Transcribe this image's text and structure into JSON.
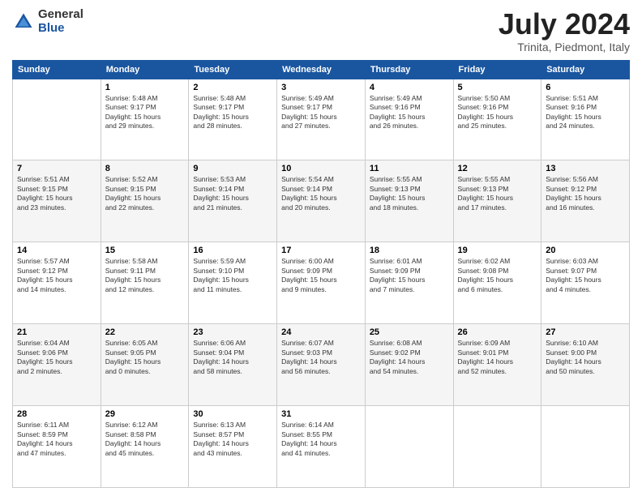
{
  "logo": {
    "general": "General",
    "blue": "Blue"
  },
  "title": "July 2024",
  "subtitle": "Trinita, Piedmont, Italy",
  "weekdays": [
    "Sunday",
    "Monday",
    "Tuesday",
    "Wednesday",
    "Thursday",
    "Friday",
    "Saturday"
  ],
  "weeks": [
    [
      {
        "day": "",
        "info": ""
      },
      {
        "day": "1",
        "info": "Sunrise: 5:48 AM\nSunset: 9:17 PM\nDaylight: 15 hours\nand 29 minutes."
      },
      {
        "day": "2",
        "info": "Sunrise: 5:48 AM\nSunset: 9:17 PM\nDaylight: 15 hours\nand 28 minutes."
      },
      {
        "day": "3",
        "info": "Sunrise: 5:49 AM\nSunset: 9:17 PM\nDaylight: 15 hours\nand 27 minutes."
      },
      {
        "day": "4",
        "info": "Sunrise: 5:49 AM\nSunset: 9:16 PM\nDaylight: 15 hours\nand 26 minutes."
      },
      {
        "day": "5",
        "info": "Sunrise: 5:50 AM\nSunset: 9:16 PM\nDaylight: 15 hours\nand 25 minutes."
      },
      {
        "day": "6",
        "info": "Sunrise: 5:51 AM\nSunset: 9:16 PM\nDaylight: 15 hours\nand 24 minutes."
      }
    ],
    [
      {
        "day": "7",
        "info": "Sunrise: 5:51 AM\nSunset: 9:15 PM\nDaylight: 15 hours\nand 23 minutes."
      },
      {
        "day": "8",
        "info": "Sunrise: 5:52 AM\nSunset: 9:15 PM\nDaylight: 15 hours\nand 22 minutes."
      },
      {
        "day": "9",
        "info": "Sunrise: 5:53 AM\nSunset: 9:14 PM\nDaylight: 15 hours\nand 21 minutes."
      },
      {
        "day": "10",
        "info": "Sunrise: 5:54 AM\nSunset: 9:14 PM\nDaylight: 15 hours\nand 20 minutes."
      },
      {
        "day": "11",
        "info": "Sunrise: 5:55 AM\nSunset: 9:13 PM\nDaylight: 15 hours\nand 18 minutes."
      },
      {
        "day": "12",
        "info": "Sunrise: 5:55 AM\nSunset: 9:13 PM\nDaylight: 15 hours\nand 17 minutes."
      },
      {
        "day": "13",
        "info": "Sunrise: 5:56 AM\nSunset: 9:12 PM\nDaylight: 15 hours\nand 16 minutes."
      }
    ],
    [
      {
        "day": "14",
        "info": "Sunrise: 5:57 AM\nSunset: 9:12 PM\nDaylight: 15 hours\nand 14 minutes."
      },
      {
        "day": "15",
        "info": "Sunrise: 5:58 AM\nSunset: 9:11 PM\nDaylight: 15 hours\nand 12 minutes."
      },
      {
        "day": "16",
        "info": "Sunrise: 5:59 AM\nSunset: 9:10 PM\nDaylight: 15 hours\nand 11 minutes."
      },
      {
        "day": "17",
        "info": "Sunrise: 6:00 AM\nSunset: 9:09 PM\nDaylight: 15 hours\nand 9 minutes."
      },
      {
        "day": "18",
        "info": "Sunrise: 6:01 AM\nSunset: 9:09 PM\nDaylight: 15 hours\nand 7 minutes."
      },
      {
        "day": "19",
        "info": "Sunrise: 6:02 AM\nSunset: 9:08 PM\nDaylight: 15 hours\nand 6 minutes."
      },
      {
        "day": "20",
        "info": "Sunrise: 6:03 AM\nSunset: 9:07 PM\nDaylight: 15 hours\nand 4 minutes."
      }
    ],
    [
      {
        "day": "21",
        "info": "Sunrise: 6:04 AM\nSunset: 9:06 PM\nDaylight: 15 hours\nand 2 minutes."
      },
      {
        "day": "22",
        "info": "Sunrise: 6:05 AM\nSunset: 9:05 PM\nDaylight: 15 hours\nand 0 minutes."
      },
      {
        "day": "23",
        "info": "Sunrise: 6:06 AM\nSunset: 9:04 PM\nDaylight: 14 hours\nand 58 minutes."
      },
      {
        "day": "24",
        "info": "Sunrise: 6:07 AM\nSunset: 9:03 PM\nDaylight: 14 hours\nand 56 minutes."
      },
      {
        "day": "25",
        "info": "Sunrise: 6:08 AM\nSunset: 9:02 PM\nDaylight: 14 hours\nand 54 minutes."
      },
      {
        "day": "26",
        "info": "Sunrise: 6:09 AM\nSunset: 9:01 PM\nDaylight: 14 hours\nand 52 minutes."
      },
      {
        "day": "27",
        "info": "Sunrise: 6:10 AM\nSunset: 9:00 PM\nDaylight: 14 hours\nand 50 minutes."
      }
    ],
    [
      {
        "day": "28",
        "info": "Sunrise: 6:11 AM\nSunset: 8:59 PM\nDaylight: 14 hours\nand 47 minutes."
      },
      {
        "day": "29",
        "info": "Sunrise: 6:12 AM\nSunset: 8:58 PM\nDaylight: 14 hours\nand 45 minutes."
      },
      {
        "day": "30",
        "info": "Sunrise: 6:13 AM\nSunset: 8:57 PM\nDaylight: 14 hours\nand 43 minutes."
      },
      {
        "day": "31",
        "info": "Sunrise: 6:14 AM\nSunset: 8:55 PM\nDaylight: 14 hours\nand 41 minutes."
      },
      {
        "day": "",
        "info": ""
      },
      {
        "day": "",
        "info": ""
      },
      {
        "day": "",
        "info": ""
      }
    ]
  ]
}
